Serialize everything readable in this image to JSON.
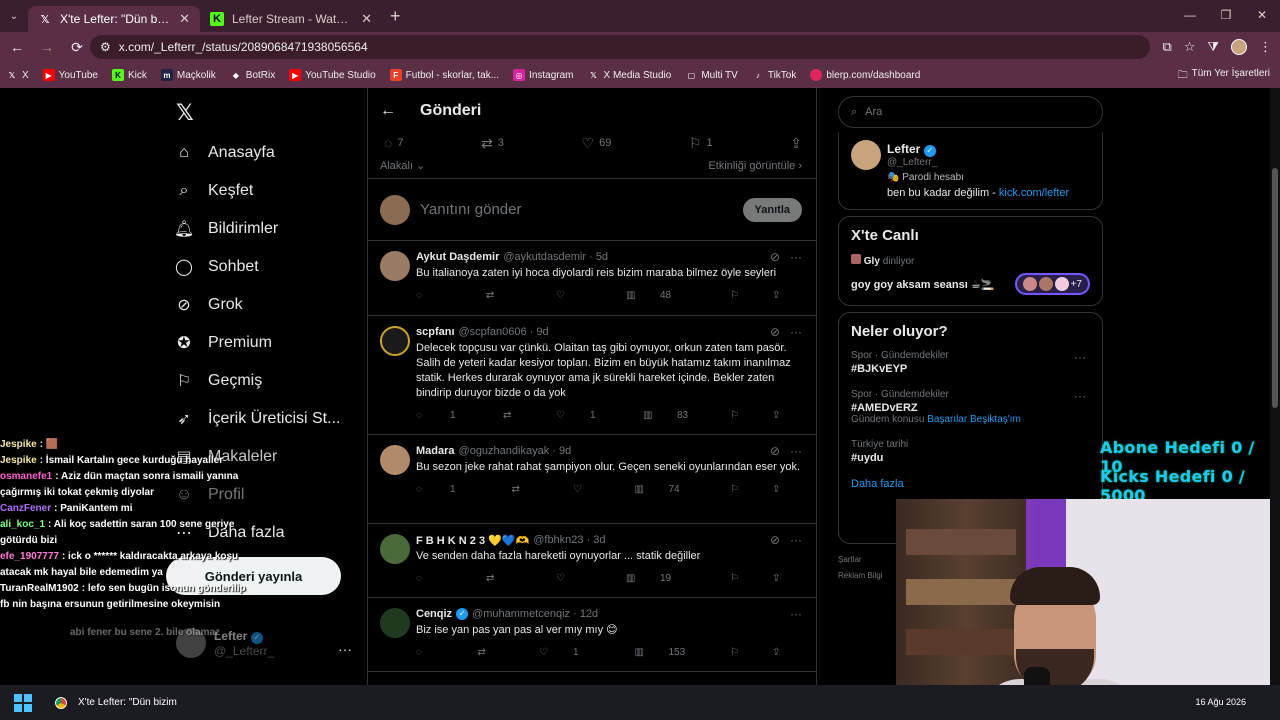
{
  "browser": {
    "tabs": [
      {
        "icon": "x-logo-icon",
        "title": "X'te Lefter: \"Dün bizim yapamad",
        "active": true
      },
      {
        "icon": "kick-logo-icon",
        "title": "Lefter Stream - Watch Live on Kick",
        "active": false
      }
    ],
    "url": "x.com/_Lefterr_/status/2089068471938056564",
    "bookmarks": [
      "X",
      "YouTube",
      "Kick",
      "Maçkolik",
      "BotRix",
      "YouTube Studio",
      "Futbol - skorlar, tak...",
      "Instagram",
      "X Media Studio",
      "Multi TV",
      "TikTok",
      "blerp.com/dashboard"
    ],
    "all_bookmarks": "Tüm Yer İşaretleri"
  },
  "nav": {
    "items": [
      "Anasayfa",
      "Keşfet",
      "Bildirimler",
      "Sohbet",
      "Grok",
      "Premium",
      "Geçmiş",
      "İçerik Üreticisi St...",
      "Makaleler",
      "Profil",
      "Daha fazla"
    ],
    "post_button": "Gönderi yayınla",
    "account_name": "Lefter",
    "account_handle": "@_Lefterr_"
  },
  "main": {
    "title": "Gönderi",
    "stats": {
      "replies": "7",
      "reposts": "3",
      "likes": "69",
      "bookmarks": "1"
    },
    "relevance": "Alakalı",
    "activity": "Etkinliği görüntüle",
    "reply_placeholder": "Yanıtını gönder",
    "reply_button": "Yanıtla",
    "posts": [
      {
        "name": "Aykut Daşdemir",
        "handle": "@aykutdasdemir · 5d",
        "text": "Bu italianoya zaten iyi hoca diyolardi reis bizim maraba bilmez öyle seyleri",
        "likes": "",
        "views": "48"
      },
      {
        "name": "scpfanı",
        "handle": "@scpfan0606 · 9d",
        "text": "Delecek topçusu var çünkü. Olaitan taş gibi oynuyor, orkun zaten tam pasör. Salih de yeteri kadar kesiyor topları. Bizim en büyük hatamız takım inanılmaz statik. Herkes durarak oynuyor ama jk sürekli hareket içinde. Bekler zaten bindirip duruyor bizde o da yok",
        "replies": "1",
        "likes": "1",
        "views": "83"
      },
      {
        "name": "Madara",
        "handle": "@oguzhandikayak · 9d",
        "text": "Bu sezon jeke rahat rahat şampiyon olur. Geçen seneki oyunlarından eser yok.",
        "replies": "1",
        "likes": "",
        "views": "74"
      },
      {
        "name": "F B H K N 2 3 💛💙🫶",
        "handle": "@fbhkn23 · 3d",
        "text": "Ve senden daha fazla hareketli oynuyorlar ... statik değiller",
        "likes": "",
        "views": "19"
      },
      {
        "name": "Cenqiz",
        "handle": "@muhammetcenqiz · 12d",
        "text": "Biz ise yan pas yan pas al ver mıy mıy 😊",
        "likes": "1",
        "views": "153"
      }
    ]
  },
  "sidebar": {
    "search_placeholder": "Ara",
    "profile": {
      "name": "Lefter",
      "handle": "@_Lefterr_",
      "parody": "Parodi hesabı",
      "bio": "ben bu kadar değilim -",
      "link": "kick.com/lefter"
    },
    "live_title": "X'te Canlı",
    "live_host": "Gly",
    "live_host_status": "dinliyor",
    "live_space": "goy goy aksam seansı ☕🚬",
    "live_count": "+7",
    "trends_title": "Neler oluyor?",
    "trends": [
      {
        "cat": "Spor · Gündemdekiler",
        "tag": "#BJKvEYP",
        "sub": ""
      },
      {
        "cat": "Spor · Gündemdekiler",
        "tag": "#AMEDvERZ",
        "sub": "Gündem konusu",
        "sub_link": "Başarılar Beşiktaş'ım"
      },
      {
        "cat": "Türkiye tarihi",
        "tag": "#uydu",
        "sub": ""
      }
    ],
    "show_more": "Daha fazla",
    "footer1": "Şartlar",
    "footer2": "Reklam Bilgi"
  },
  "stream_overlay": {
    "goal1": "Abone Hedefi 0 / 10",
    "goal2": "Kicks Hedefi 0 / 5000",
    "chat": [
      {
        "user": "Jespike",
        "msg": ": 🟫"
      },
      {
        "user": "Jespike",
        "msg": ": İsmail Kartalın gece kurduğu hayaller"
      },
      {
        "user": "osmanefe1",
        "msg": ": Aziz dün maçtan sonra ismaili yanına çağırmış iki tokat çekmiş diyolar"
      },
      {
        "user": "CanzFener",
        "msg": ": PaniKantem mi"
      },
      {
        "user": "ali_koc_1",
        "msg": ": Ali koç sadettin saran 100 sene geriye götürdü bizi"
      },
      {
        "user": "efe_1907777",
        "msg": ": ick o ****** kaldıracakta arkaya koşu atacak mk hayal bile edemedim ya"
      },
      {
        "user": "TuranRealM1902",
        "msg": ": lefo sen bugün isonun gönderilip fb nin başına ersunun getirilmesine okeymisin"
      },
      {
        "user": "",
        "msg": "abi fener bu sene 2. bile olamaz"
      }
    ]
  },
  "taskbar": {
    "window_title": "X'te Lefter: \"Dün bizim y",
    "date": "16 Ağu 2026"
  }
}
